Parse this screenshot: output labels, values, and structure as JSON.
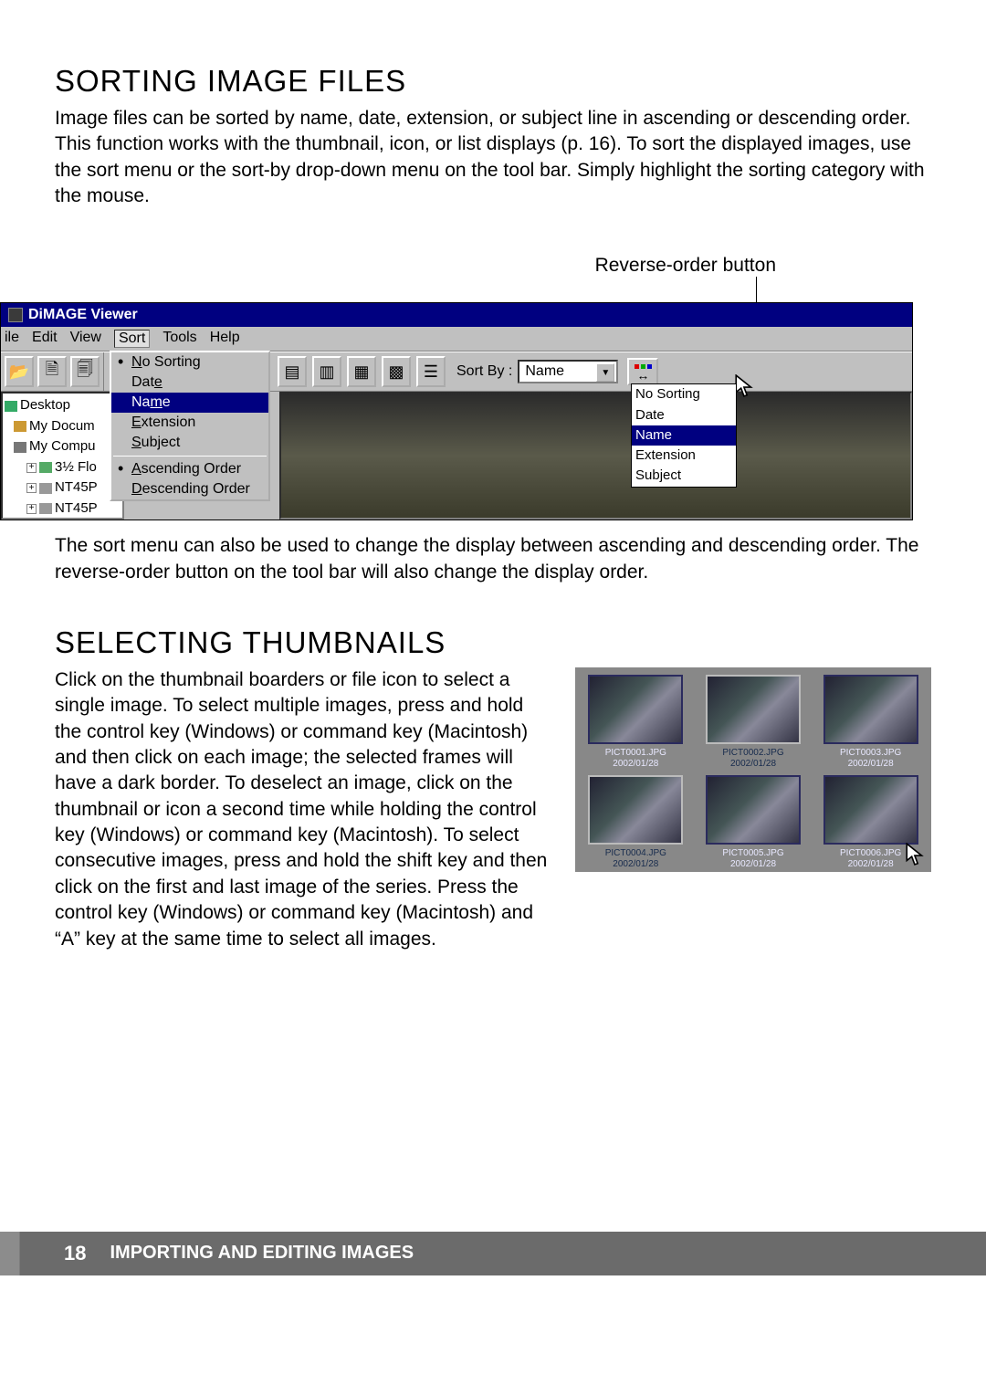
{
  "headings": {
    "h1a": "SORTING IMAGE FILES",
    "h1b": "SELECTING THUMBNAILS"
  },
  "paragraphs": {
    "p1": "Image files can be sorted by name, date, extension, or subject line in ascending or descending order. This function works with the thumbnail, icon, or list displays (p. 16). To sort the displayed images, use the sort menu or the sort-by drop-down menu on the tool bar. Simply highlight the sorting category with the mouse.",
    "callout": "Reverse-order button",
    "p2": "The sort menu can also be used to change the display between ascending and descending order. The reverse-order button on the tool bar will also change the display order.",
    "p3": "Click on the thumbnail boarders or file icon to select a single image. To select multiple images, press and hold the control key (Windows) or command key (Macintosh) and then click on each image; the selected frames will have a dark border. To deselect an image, click on the thumbnail or icon a second time while holding the control key (Windows) or command key (Macintosh). To select consecutive images, press and hold the shift key and then click on the first and last image of the series. Press the control key (Windows) or command key (Macintosh) and “A” key at the same time to select all images."
  },
  "app": {
    "title": "DiMAGE Viewer",
    "menubar": [
      "ile",
      "Edit",
      "View",
      "Sort",
      "Tools",
      "Help"
    ],
    "sortby_label": "Sort By :",
    "sortby_value": "Name",
    "sort_menu": {
      "items": [
        {
          "label": "No Sorting",
          "bullet": true
        },
        {
          "label": "Date"
        },
        {
          "label": "Name",
          "selected": true
        },
        {
          "label": "Extension"
        },
        {
          "label": "Subject"
        }
      ],
      "after_sep": [
        {
          "label": "Ascending Order",
          "bullet": true
        },
        {
          "label": "Descending Order"
        }
      ]
    },
    "sort_dropdown": [
      "No Sorting",
      "Date",
      "Name",
      "Extension",
      "Subject"
    ],
    "sort_dropdown_selected": "Name",
    "tree": {
      "root": "Desktop",
      "items": [
        {
          "label": "My Docum",
          "icon": "ico-docs"
        },
        {
          "label": "My Compu",
          "icon": "ico-comp"
        },
        {
          "label": "3½ Flo",
          "icon": "ico-floppy",
          "plus": true,
          "indent": 2
        },
        {
          "label": "NT45P",
          "icon": "ico-drive",
          "plus": true,
          "indent": 2
        },
        {
          "label": "NT45P",
          "icon": "ico-drive",
          "plus": true,
          "indent": 2
        }
      ]
    }
  },
  "thumbs": [
    {
      "name": "PICT0001.JPG",
      "date": "2002/01/28",
      "sel": true
    },
    {
      "name": "PICT0002.JPG",
      "date": "2002/01/28",
      "sel": false
    },
    {
      "name": "PICT0003.JPG",
      "date": "2002/01/28",
      "sel": true
    },
    {
      "name": "PICT0004.JPG",
      "date": "2002/01/28",
      "sel": false
    },
    {
      "name": "PICT0005.JPG",
      "date": "2002/01/28",
      "sel": true
    },
    {
      "name": "PICT0006.JPG",
      "date": "2002/01/28",
      "sel": true
    }
  ],
  "footer": {
    "page": "18",
    "section": "IMPORTING AND EDITING IMAGES"
  }
}
